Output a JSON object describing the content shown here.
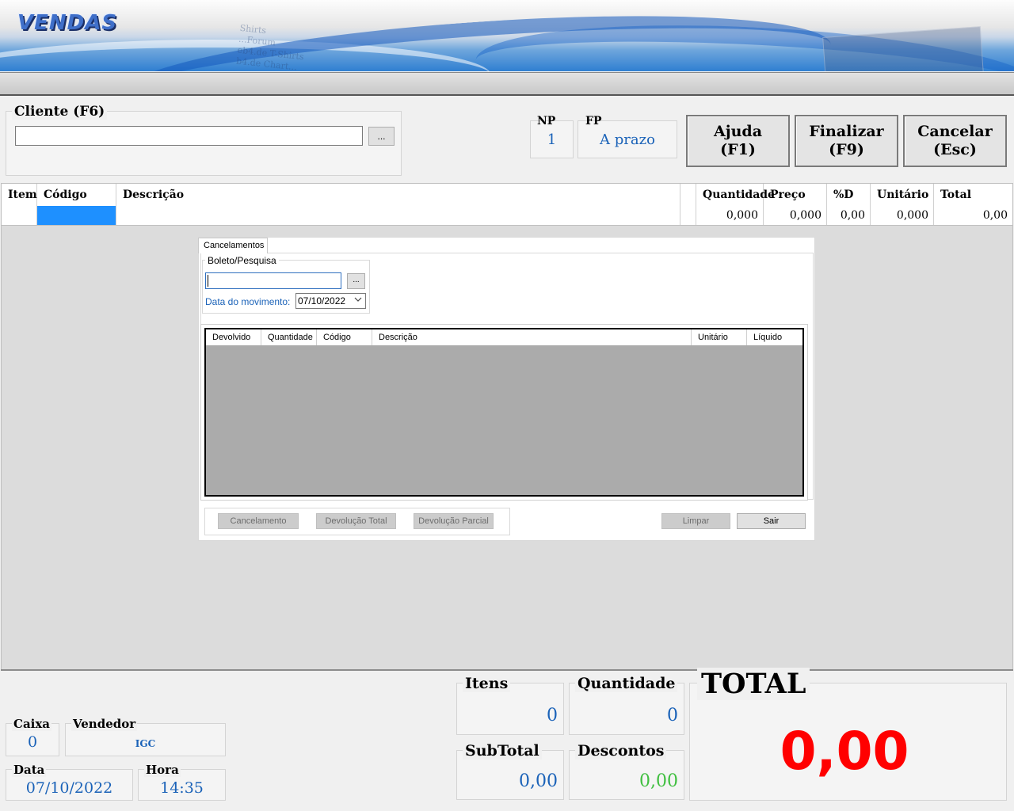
{
  "app": {
    "title": "VENDAS"
  },
  "banner": {
    "paper_lines": [
      "Shirts",
      "...Forum",
      "eb4.de T-Shirts",
      "b4.de Chart..."
    ]
  },
  "cliente": {
    "label": "Cliente (F6)",
    "value": "",
    "browse_label": "..."
  },
  "np": {
    "label": "NP",
    "value": "1"
  },
  "fp": {
    "label": "FP",
    "value": "A prazo"
  },
  "buttons": {
    "ajuda": {
      "line1": "Ajuda",
      "line2": "(F1)"
    },
    "finalizar": {
      "line1": "Finalizar",
      "line2": "(F9)"
    },
    "cancelar": {
      "line1": "Cancelar",
      "line2": "(Esc)"
    }
  },
  "grid": {
    "headers": [
      "Item",
      "Código",
      "Descrição",
      "",
      "Quantidade",
      "Preço",
      "%D",
      "Unitário",
      "Total"
    ],
    "row": {
      "item": "",
      "codigo": "",
      "descricao": "",
      "quantidade": "0,000",
      "preco": "0,000",
      "desconto": "0,00",
      "unitario": "0,000",
      "total": "0,00"
    }
  },
  "dialog": {
    "tab": "Cancelamentos",
    "boleto_label": "Boleto/Pesquisa",
    "boleto_value": "",
    "browse_label": "...",
    "data_label": "Data do movimento:",
    "data_value": "07/10/2022",
    "columns": [
      "Devolvido",
      "Quantidade",
      "Código",
      "Descrição",
      "Unitário",
      "Líquido"
    ],
    "btn_cancelamento": "Cancelamento",
    "btn_devolucao_total": "Devolução Total",
    "btn_devolucao_parcial": "Devolução Parcial",
    "btn_limpar": "Limpar",
    "btn_sair": "Sair"
  },
  "footer": {
    "caixa": {
      "label": "Caixa",
      "value": "0"
    },
    "vendedor": {
      "label": "Vendedor",
      "value": "IGC"
    },
    "data": {
      "label": "Data",
      "value": "07/10/2022"
    },
    "hora": {
      "label": "Hora",
      "value": "14:35"
    },
    "itens": {
      "label": "Itens",
      "value": "0"
    },
    "quantidade": {
      "label": "Quantidade",
      "value": "0"
    },
    "subtotal": {
      "label": "SubTotal",
      "value": "0,00"
    },
    "descontos": {
      "label": "Descontos",
      "value": "0,00"
    },
    "total": {
      "label": "TOTAL",
      "value": "0,00"
    }
  },
  "colors": {
    "accent_blue": "#1a62b8",
    "total_red": "#ff0000",
    "discount_green": "#3fbf3f",
    "selection_blue": "#1e90ff"
  }
}
